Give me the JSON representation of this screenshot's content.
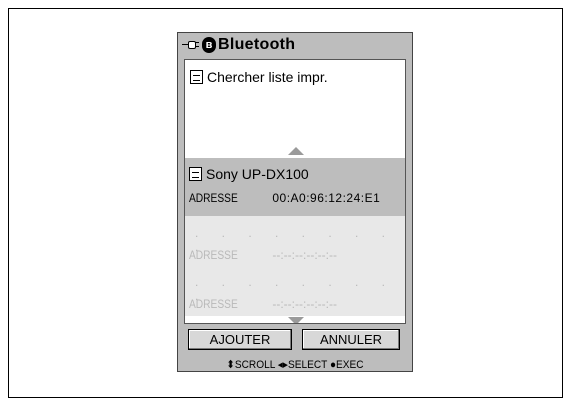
{
  "window": {
    "title": "Bluetooth"
  },
  "search": {
    "label": "Chercher liste impr."
  },
  "device": {
    "name": "Sony  UP-DX100",
    "address_label": "ADRESSE",
    "address_value": "00:A0:96:12:24:E1"
  },
  "empty_slots": [
    {
      "dots": ". . . . . . . . .",
      "address_label": "ADRESSE",
      "address_value": "--:--:--:--:--:--"
    },
    {
      "dots": ". . . . . . . . .",
      "address_label": "ADRESSE",
      "address_value": "--:--:--:--:--:--"
    }
  ],
  "buttons": {
    "add": "AJOUTER",
    "cancel": "ANNULER"
  },
  "help": {
    "text": "⬍SCROLL ◂▸SELECT ●EXEC"
  },
  "icons": {
    "connector": "usb-connector-icon",
    "bluetooth": "bluetooth-icon",
    "document": "document-icon",
    "scroll_up": "arrow-up-icon",
    "scroll_down": "arrow-down-icon"
  },
  "colors": {
    "frame": "#bdbdbd",
    "selected": "#bdbdbd",
    "empty": "#e8e8e8",
    "arrow": "#9a9a9a"
  }
}
